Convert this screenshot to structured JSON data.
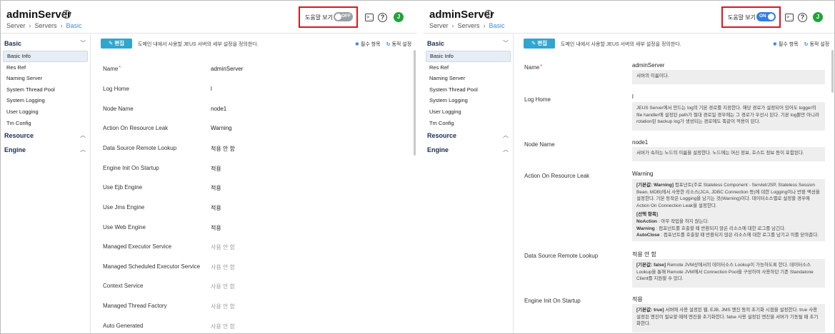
{
  "app": {
    "title": "adminServer",
    "breadcrumb": [
      "Server",
      "Servers",
      "Basic"
    ]
  },
  "header": {
    "help_label": "도움말 보기",
    "toggle_off": "OFF",
    "toggle_on": "ON",
    "avatar_initial": "J"
  },
  "sidebar": {
    "groups": {
      "basic": "Basic",
      "resource": "Resource",
      "engine": "Engine"
    },
    "items": [
      "Basic Info",
      "Res Ref",
      "Naming Server",
      "System Thread Pool",
      "System Logging",
      "User Logging",
      "Tm Config"
    ]
  },
  "toolbar": {
    "edit_label": "편집",
    "description": "도메인 내에서 사용할 JEUS 서버의 세부 설정을 정의한다.",
    "required_legend": "필수 항목",
    "dynamic_legend": "동적 설정"
  },
  "fields": [
    {
      "label": "Name",
      "value": "adminServer",
      "required": true
    },
    {
      "label": "Log Home",
      "value": "l"
    },
    {
      "label": "Node Name",
      "value": "node1"
    },
    {
      "label": "Action On Resource Leak",
      "value": "Warning"
    },
    {
      "label": "Data Source Remote Lookup",
      "value": "적용 안 함"
    },
    {
      "label": "Engine Init On Startup",
      "value": "적용"
    },
    {
      "label": "Use Ejb Engine",
      "value": "적용"
    },
    {
      "label": "Use Jms Engine",
      "value": "적용"
    },
    {
      "label": "Use Web Engine",
      "value": "적용"
    },
    {
      "label": "Managed Executor Service",
      "value": "사용 안 함",
      "unset": true
    },
    {
      "label": "Managed Scheduled Executor Service",
      "value": "사용 안 함",
      "unset": true
    },
    {
      "label": "Context Service",
      "value": "사용 안 함",
      "unset": true
    },
    {
      "label": "Managed Thread Factory",
      "value": "사용 안 함",
      "unset": true
    },
    {
      "label": "Auto Generated",
      "value": "사용 안 함",
      "unset": true
    }
  ],
  "help": {
    "name": "서버의 이름이다.",
    "log_home": "JEUS Server에서 만드는 log의 기본 경로를 지정한다. 해당 경로가 설정되어 있어도 logger의 file handler에 설정된 path가 절대 경로일 경우에는 그 경로가 우선시 된다. 기본 log뿐만 아니라 rotation된 backup log가 생성되는 경로에도 똑같이 적용이 된다.",
    "node_name": "서버가 속하는 노드의 이름을 설정한다. 노드에는 머신 정보, 호스트 정보 등이 포함된다.",
    "action_default_key": "[기본값: Warning]",
    "action_default_text": " 컴포넌트(주로 Stateless Component - Servlet/JSP, Stateless Session Bean, MDB)에서 사용한 리소스(JCA, JDBC Connection 등)에 대한 Logging이나 반환 액션을 설정한다. 기본 동작은 Logging을 남기는 것(Warning)이다. 데이터소스별로 설정할 경우에 Action On Connection Leak을 설정한다.",
    "action_options_title": "[선택 항목]",
    "action_opt1_key": "NoAction",
    "action_opt1_text": " : 아무 작업을 하지 않는다.",
    "action_opt2_key": "Warning",
    "action_opt2_text": " : 컴포넌트를 호출할 때 반환되지 않은 리소스에 대한 로그를 남긴다.",
    "action_opt3_key": "AutoClose",
    "action_opt3_text": " : 컴포넌트를 호출할 때 반환되지 않은 리소스에 대한 로그를 남기고 이를 닫아준다.",
    "dsrl_key": "[기본값: false]",
    "dsrl_text": " Remote JVM상에서의 데이터소스 Lookup이 가능하도록 한다. 데이터소스 Lookup을 통해 Remote JVM에서 Connection Pool을 구성하여 사용하던 기존 Standalone Client를 지원할 수 있다.",
    "eios_key": "[기본값: true]",
    "eios_text": " 서버에 사용 설정된 웹, EJB, JMS 엔진 등의 초기화 시점을 설정한다. true 사용 설정된 엔진이 필요할 때에 엔진을 초기화한다. false 사용 설정된 엔진을 서버가 기동될 때 초기화한다."
  },
  "colors": {
    "highlight_border": "#e0141b",
    "accent": "#2f80e4",
    "edit_button": "#2fa6cf",
    "avatar": "#22a33a"
  }
}
